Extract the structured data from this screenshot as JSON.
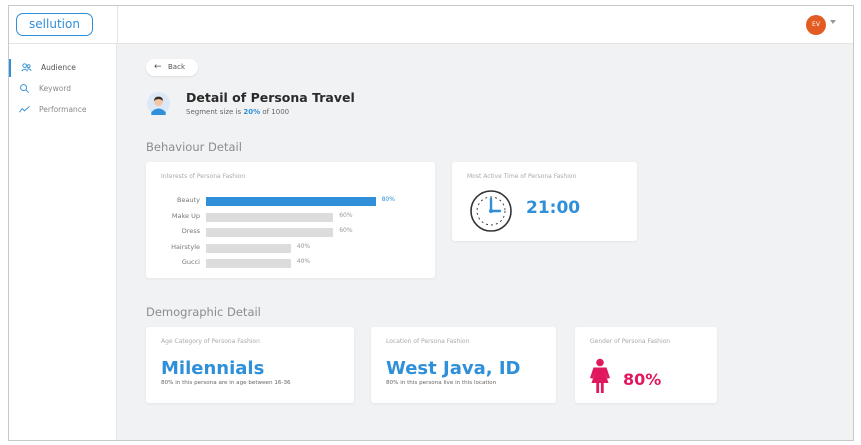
{
  "app": {
    "logo_text": "sellution"
  },
  "user": {
    "initials": "EV"
  },
  "sidebar": {
    "items": [
      {
        "label": "Audience",
        "icon": "users-icon",
        "active": true
      },
      {
        "label": "Keyword",
        "icon": "search-icon",
        "active": false
      },
      {
        "label": "Performance",
        "icon": "trend-icon",
        "active": false
      }
    ]
  },
  "header": {
    "back_label": "Back",
    "title": "Detail of Persona Travel",
    "segment_prefix": "Segment size is ",
    "segment_pct": "20%",
    "segment_suffix": " of 1000"
  },
  "behaviour": {
    "section_title": "Behaviour Detail",
    "interests": {
      "title": "Interests of Persona Fashion",
      "items": [
        {
          "name": "Beauty",
          "pct_label": "80%",
          "value": 80
        },
        {
          "name": "Make Up",
          "pct_label": "60%",
          "value": 60
        },
        {
          "name": "Dress",
          "pct_label": "60%",
          "value": 60
        },
        {
          "name": "Hairstyle",
          "pct_label": "40%",
          "value": 40
        },
        {
          "name": "Gucci",
          "pct_label": "40%",
          "value": 40
        }
      ]
    },
    "active_time": {
      "title": "Most Active Time of Persona Fashion",
      "value": "21:00"
    }
  },
  "demographic": {
    "section_title": "Demographic Detail",
    "age": {
      "title": "Age Category of Persona Fashion",
      "value": "Milennials",
      "sub": "80% in this persona are in age between 16-36"
    },
    "location": {
      "title": "Location of Persona Fashion",
      "value": "West Java, ID",
      "sub": "80% in this persona live in this location"
    },
    "gender": {
      "title": "Gender of Persona Fashion",
      "value": "80%",
      "icon": "female-icon"
    }
  },
  "colors": {
    "accent": "#2f8fd8",
    "gender": "#e0195e",
    "avatar": "#e25b22"
  }
}
